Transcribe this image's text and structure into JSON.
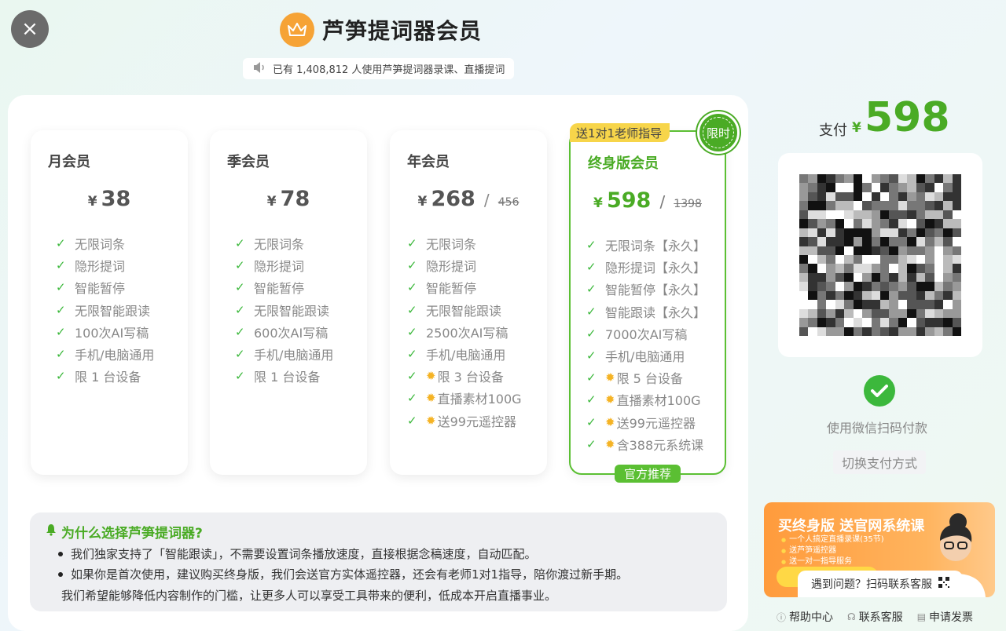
{
  "header": {
    "close_icon": "×",
    "title": "芦笋提词器会员",
    "user_count": "已有 1,408,812 人使用芦笋提词器录课、直播提词"
  },
  "plans": [
    {
      "name": "月会员",
      "currency": "¥",
      "price": "38",
      "original_price": "",
      "features": [
        {
          "text": "无限词条",
          "icon": "check"
        },
        {
          "text": "隐形提词",
          "icon": "check"
        },
        {
          "text": "智能暂停",
          "icon": "check"
        },
        {
          "text": "无限智能跟读",
          "icon": "check"
        },
        {
          "text": "100次AI写稿",
          "icon": "check"
        },
        {
          "text": "手机/电脑通用",
          "icon": "check"
        },
        {
          "text": "限 1 台设备",
          "icon": "check"
        }
      ]
    },
    {
      "name": "季会员",
      "currency": "¥",
      "price": "78",
      "original_price": "",
      "features": [
        {
          "text": "无限词条",
          "icon": "check"
        },
        {
          "text": "隐形提词",
          "icon": "check"
        },
        {
          "text": "智能暂停",
          "icon": "check"
        },
        {
          "text": "无限智能跟读",
          "icon": "check"
        },
        {
          "text": "600次AI写稿",
          "icon": "check"
        },
        {
          "text": "手机/电脑通用",
          "icon": "check"
        },
        {
          "text": "限 1 台设备",
          "icon": "check"
        }
      ]
    },
    {
      "name": "年会员",
      "currency": "¥",
      "price": "268",
      "original_price": "456",
      "features": [
        {
          "text": "无限词条",
          "icon": "check"
        },
        {
          "text": "隐形提词",
          "icon": "check"
        },
        {
          "text": "智能暂停",
          "icon": "check"
        },
        {
          "text": "无限智能跟读",
          "icon": "check"
        },
        {
          "text": "2500次AI写稿",
          "icon": "check"
        },
        {
          "text": "手机/电脑通用",
          "icon": "check"
        },
        {
          "text": "限 3 台设备",
          "icon": "check-sun"
        },
        {
          "text": "直播素材100G",
          "icon": "check-sun"
        },
        {
          "text": "送99元遥控器",
          "icon": "check-sun"
        }
      ]
    },
    {
      "name": "终身版会员",
      "currency": "¥",
      "price": "598",
      "original_price": "1398",
      "features": [
        {
          "text": "无限词条【永久】",
          "icon": "check"
        },
        {
          "text": "隐形提词【永久】",
          "icon": "check"
        },
        {
          "text": "智能暂停【永久】",
          "icon": "check"
        },
        {
          "text": "智能跟读【永久】",
          "icon": "check"
        },
        {
          "text": "7000次AI写稿",
          "icon": "check"
        },
        {
          "text": "手机/电脑通用",
          "icon": "check"
        },
        {
          "text": "限 5 台设备",
          "icon": "check-sun"
        },
        {
          "text": "直播素材100G",
          "icon": "check-sun"
        },
        {
          "text": "送99元遥控器",
          "icon": "check-sun"
        },
        {
          "text": "含388元系统课",
          "icon": "check-sun"
        }
      ]
    }
  ],
  "featured": {
    "teacher_tag": "送1对1老师指导",
    "limited_badge": "限时",
    "recommend_label": "官方推荐"
  },
  "why": {
    "title": "为什么选择芦笋提词器?",
    "items": [
      "我们独家支持了「智能跟读」，不需要设置词条播放速度，直接根据念稿速度，自动匹配。",
      "如果你是首次使用，建议购买终身版，我们会送官方实体遥控器，还会有老师1对1指导，陪你渡过新手期。"
    ],
    "closing": "我们希望能够降低内容制作的门槛，让更多人可以享受工具带来的便利，低成本开启直播事业。"
  },
  "payment": {
    "label": "支付",
    "currency": "¥",
    "amount": "598",
    "wechat_text": "使用微信扫码付款",
    "switch_label": "切换支付方式"
  },
  "promo": {
    "title": "买终身版 送官网系统课",
    "lines": [
      "一个人搞定直播录课(35节)",
      "送芦笋遥控器",
      "送一对一指导服务"
    ]
  },
  "help_bubble": "遇到问题？扫码联系客服",
  "footer": {
    "help_center": "帮助中心",
    "contact_service": "联系客服",
    "invoice": "申请发票"
  },
  "colors": {
    "accent_green": "#4aab25",
    "crown_orange": "#f6a336",
    "tag_yellow": "#f7d54a"
  }
}
